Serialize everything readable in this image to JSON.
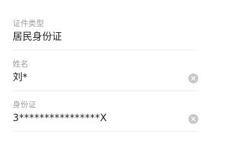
{
  "form": {
    "fields": [
      {
        "label": "证件类型",
        "value": "居民身份证",
        "clearable": false
      },
      {
        "label": "姓名",
        "value": "刘*",
        "clearable": true,
        "clear_icon": "clear-icon"
      },
      {
        "label": "身份证",
        "value": "3****************X",
        "clearable": true,
        "clear_icon": "clear-icon"
      }
    ]
  },
  "colors": {
    "label": "#9a9a9a",
    "value": "#1f1f1f",
    "divider": "#efefef",
    "clear_icon_bg": "#c7c7c7",
    "clear_icon_fg": "#ffffff"
  }
}
